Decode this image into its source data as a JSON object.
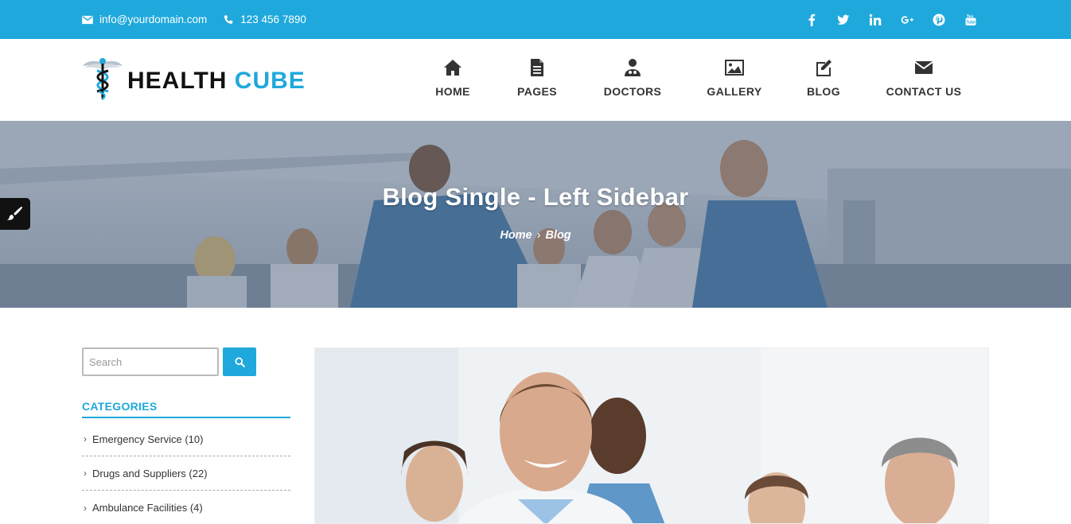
{
  "topbar": {
    "email": "info@yourdomain.com",
    "phone": "123 456 7890",
    "social": [
      "facebook-icon",
      "twitter-icon",
      "linkedin-icon",
      "google-plus-icon",
      "pinterest-icon",
      "youtube-icon"
    ]
  },
  "logo": {
    "part1": "HEALTH",
    "part2": "CUBE"
  },
  "nav": [
    {
      "label": "HOME",
      "icon": "home-icon"
    },
    {
      "label": "PAGES",
      "icon": "document-icon"
    },
    {
      "label": "DOCTORS",
      "icon": "doctor-icon"
    },
    {
      "label": "GALLERY",
      "icon": "image-icon"
    },
    {
      "label": "BLOG",
      "icon": "edit-icon"
    },
    {
      "label": "CONTACT US",
      "icon": "envelope-icon"
    }
  ],
  "hero": {
    "title": "Blog Single - Left Sidebar",
    "breadcrumb": [
      "Home",
      "Blog"
    ],
    "separator": "›"
  },
  "sidebar": {
    "search_placeholder": "Search",
    "categories_title": "CATEGORIES",
    "categories": [
      {
        "label": "Emergency Service (10)"
      },
      {
        "label": "Drugs and Suppliers (22)"
      },
      {
        "label": "Ambulance Facilities (4)"
      }
    ]
  },
  "colors": {
    "accent": "#1fa8dc",
    "text": "#333333"
  }
}
